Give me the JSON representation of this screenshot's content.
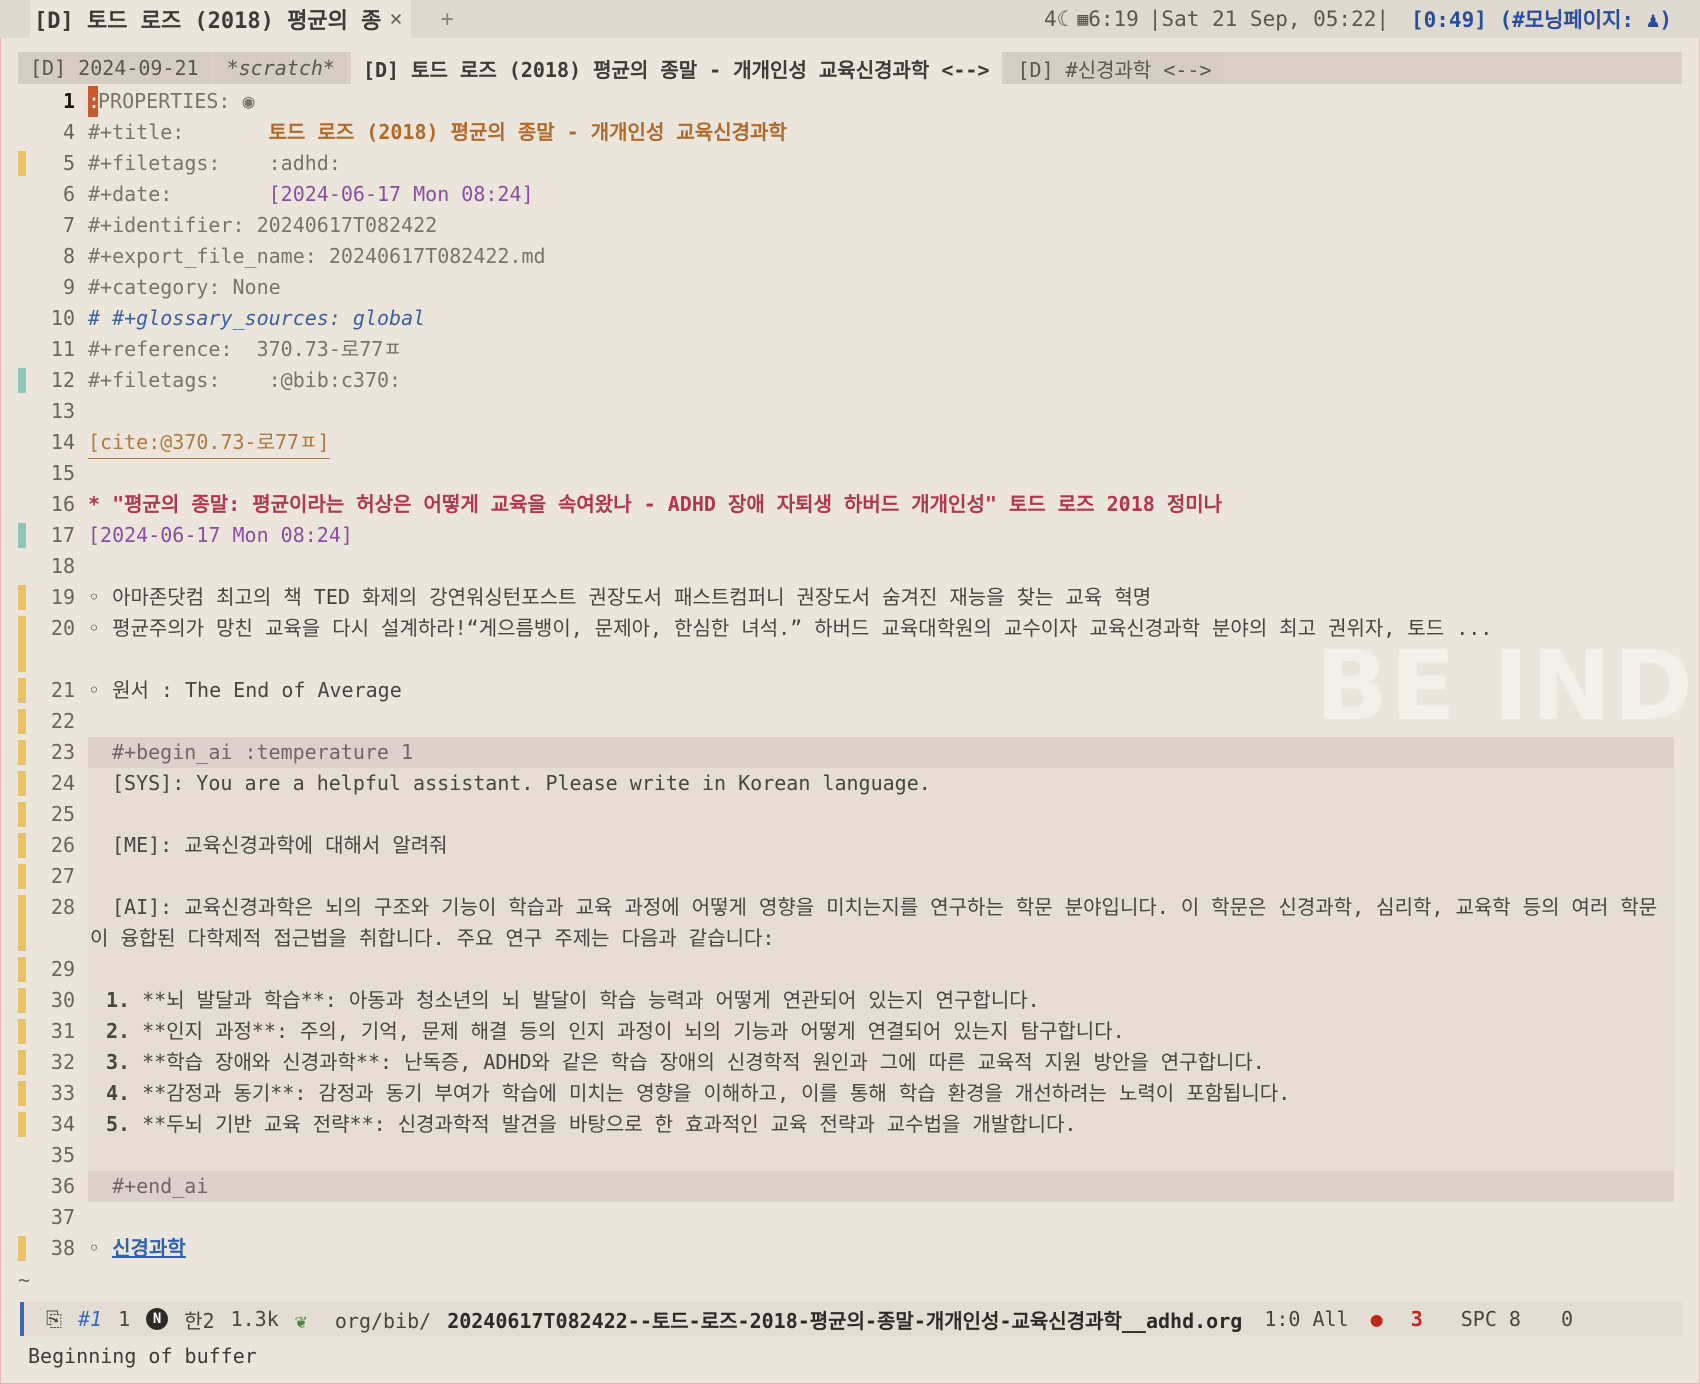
{
  "topbar": {
    "tab_title": "[D] 토드 로즈 (2018) 평균의 종",
    "close_glyph": "×",
    "new_tab_glyph": "+",
    "moon_count": "4",
    "sunrise": "6:19",
    "datetime": "|Sat 21 Sep, 05:22|",
    "clock": "[0:49] (#모닝페이지: ",
    "clock_end": ")"
  },
  "buffer_tabs": [
    {
      "label": "[D] 2024-09-21"
    },
    {
      "label": "*scratch*"
    },
    {
      "label": "[D] 토드 로즈 (2018) 평균의 종말 - 개개인성 교육신경과학 <-->"
    },
    {
      "label": "[D] #신경과학 <-->"
    }
  ],
  "lines": {
    "l1": {
      "num": "1",
      "text": "PROPERTIES: ",
      "cursor": ":"
    },
    "l4": {
      "num": "4",
      "key": "#+title:       ",
      "val": "토드 로즈 (2018) 평균의 종말 - 개개인성 교육신경과학"
    },
    "l5": {
      "num": "5",
      "text": "#+filetags:    :adhd:"
    },
    "l6": {
      "num": "6",
      "key": "#+date:        ",
      "val": "[2024-06-17 Mon 08:24]"
    },
    "l7": {
      "num": "7",
      "text": "#+identifier: 20240617T082422"
    },
    "l8": {
      "num": "8",
      "text": "#+export_file_name: 20240617T082422.md"
    },
    "l9": {
      "num": "9",
      "text": "#+category: None"
    },
    "l10": {
      "num": "10",
      "text": "# #+glossary_sources: global"
    },
    "l11": {
      "num": "11",
      "text": "#+reference:  370.73-로77ㅍ"
    },
    "l12": {
      "num": "12",
      "text": "#+filetags:    :@bib:c370:"
    },
    "l13": {
      "num": "13",
      "text": ""
    },
    "l14": {
      "num": "14",
      "text": "[cite:@370.73-로77ㅍ]"
    },
    "l15": {
      "num": "15",
      "text": ""
    },
    "l16": {
      "num": "16",
      "text": "* \"평균의 종말: 평균이라는 허상은 어떻게 교육을 속여왔나 - ADHD 장애 자퇴생 하버드 개개인성\" 토드 로즈 2018 정미나"
    },
    "l17": {
      "num": "17",
      "text": "[2024-06-17 Mon 08:24]"
    },
    "l18": {
      "num": "18",
      "text": ""
    },
    "l19": {
      "num": "19",
      "text": "◦ 아마존닷컴 최고의 책 TED 화제의 강연워싱턴포스트 권장도서 패스트컴퍼니 권장도서 숨겨진 재능을 찾는 교육 혁명"
    },
    "l20": {
      "num": "20",
      "text": "◦ 평균주의가 망친 교육을 다시 설계하라!“게으름뱅이, 문제아, 한심한 녀석.” 하버드 교육대학원의 교수이자 교육신경과학 분야의 최고 권위자, 토드 ..."
    },
    "l21": {
      "num": "21",
      "text": "◦ 원서 : The End of Average"
    },
    "l22": {
      "num": "22",
      "text": ""
    },
    "l23": {
      "num": "23",
      "text": "#+begin_ai :temperature 1"
    },
    "l24": {
      "num": "24",
      "text": "[SYS]: You are a helpful assistant. Please write in Korean language."
    },
    "l25": {
      "num": "25",
      "text": ""
    },
    "l26": {
      "num": "26",
      "text": "[ME]: 교육신경과학에 대해서 알려줘"
    },
    "l27": {
      "num": "27",
      "text": ""
    },
    "l28": {
      "num": "28",
      "text": "[AI]: 교육신경과학은 뇌의 구조와 기능이 학습과 교육 과정에 어떻게 영향을 미치는지를 연구하는 학문 분야입니다. 이 학문은 신경과학, 심리학, 교육학 등의 여러 학문이 융합된 다학제적 접근법을 취합니다. 주요 연구 주제는 다음과 같습니다:"
    },
    "l29": {
      "num": "29",
      "text": ""
    },
    "l30": {
      "num": "30",
      "n": "1.",
      "text": "**뇌 발달과 학습**: 아동과 청소년의 뇌 발달이 학습 능력과 어떻게 연관되어 있는지 연구합니다."
    },
    "l31": {
      "num": "31",
      "n": "2.",
      "text": "**인지 과정**: 주의, 기억, 문제 해결 등의 인지 과정이 뇌의 기능과 어떻게 연결되어 있는지 탐구합니다."
    },
    "l32": {
      "num": "32",
      "n": "3.",
      "text": "**학습 장애와 신경과학**: 난독증, ADHD와 같은 학습 장애의 신경학적 원인과 그에 따른 교육적 지원 방안을 연구합니다."
    },
    "l33": {
      "num": "33",
      "n": "4.",
      "text": "**감정과 동기**: 감정과 동기 부여가 학습에 미치는 영향을 이해하고, 이를 통해 학습 환경을 개선하려는 노력이 포함됩니다."
    },
    "l34": {
      "num": "34",
      "n": "5.",
      "text": "**두뇌 기반 교육 전략**: 신경과학적 발견을 바탕으로 한 효과적인 교육 전략과 교수법을 개발합니다."
    },
    "l35": {
      "num": "35",
      "text": ""
    },
    "l36": {
      "num": "36",
      "text": "#+end_ai"
    },
    "l37": {
      "num": "37",
      "text": ""
    },
    "l38": {
      "num": "38",
      "bullet": "◦ ",
      "text": "신경과학"
    }
  },
  "watermark": "BE INDIST",
  "tilde": "~",
  "modeline": {
    "tab": "#1",
    "one": "1",
    "n_badge": "N",
    "hangul": "한2",
    "size": "1.3k",
    "path_dir": "org/bib/",
    "path_file": "20240617T082422--토드-로즈-2018-평균의-종말-개개인성-교육신경과학__adhd.org",
    "position": "1:0 All",
    "gh_count": "3",
    "spc": "SPC 8",
    "zero": "0"
  },
  "echo": "Beginning of buffer",
  "colors": {
    "accent": "#3a6ab8",
    "heading": "#b0374c",
    "title": "#b06a2c",
    "date": "#8a4fa0"
  }
}
